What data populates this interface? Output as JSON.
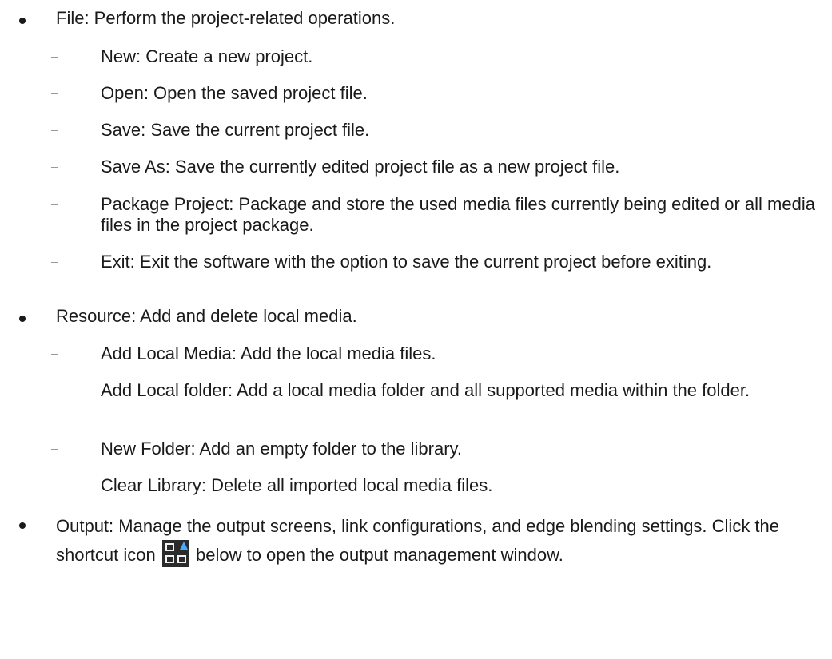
{
  "file": {
    "text": "File: Perform the project-related operations.",
    "sub": [
      "New: Create a new project.",
      "Open: Open the saved project file.",
      "Save: Save the current project file.",
      "Save As: Save the currently edited project file as a new project file.",
      "Package Project: Package and store the used media files currently being edited or all media files in the project package.",
      "Exit: Exit the software with the option to save the current project before exiting."
    ]
  },
  "resource": {
    "text": "Resource: Add and delete local media.",
    "sub": [
      "Add Local Media: Add the local media files.",
      "Add Local folder: Add a local media folder and all supported media within the folder.",
      "New Folder: Add an empty folder to the library.",
      "Clear Library: Delete all imported local media files."
    ]
  },
  "output": {
    "text_before": "Output: Manage the output screens, link configurations, and edge blending settings. Click the shortcut icon",
    "icon": "output-management-icon",
    "text_after": "below to open the output management window."
  }
}
